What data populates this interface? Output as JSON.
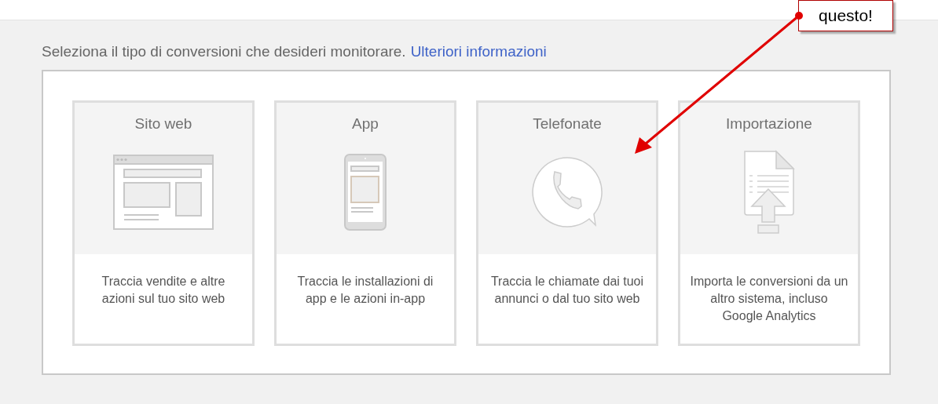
{
  "intro": {
    "text": "Seleziona il tipo di conversioni che desideri monitorare.",
    "link": "Ulteriori informazioni"
  },
  "cards": [
    {
      "kind": "web",
      "title": "Sito web",
      "description": "Traccia vendite e altre azioni sul tuo sito web"
    },
    {
      "kind": "app",
      "title": "App",
      "description": "Traccia le installazioni di app e le azioni in-app"
    },
    {
      "kind": "phone",
      "title": "Telefonate",
      "description": "Traccia le chiamate dai tuoi annunci o dal tuo sito web"
    },
    {
      "kind": "import",
      "title": "Importazione",
      "description": "Importa le conversioni da un altro sistema, incluso Google Analytics"
    }
  ],
  "callout": {
    "text": "questo!"
  }
}
